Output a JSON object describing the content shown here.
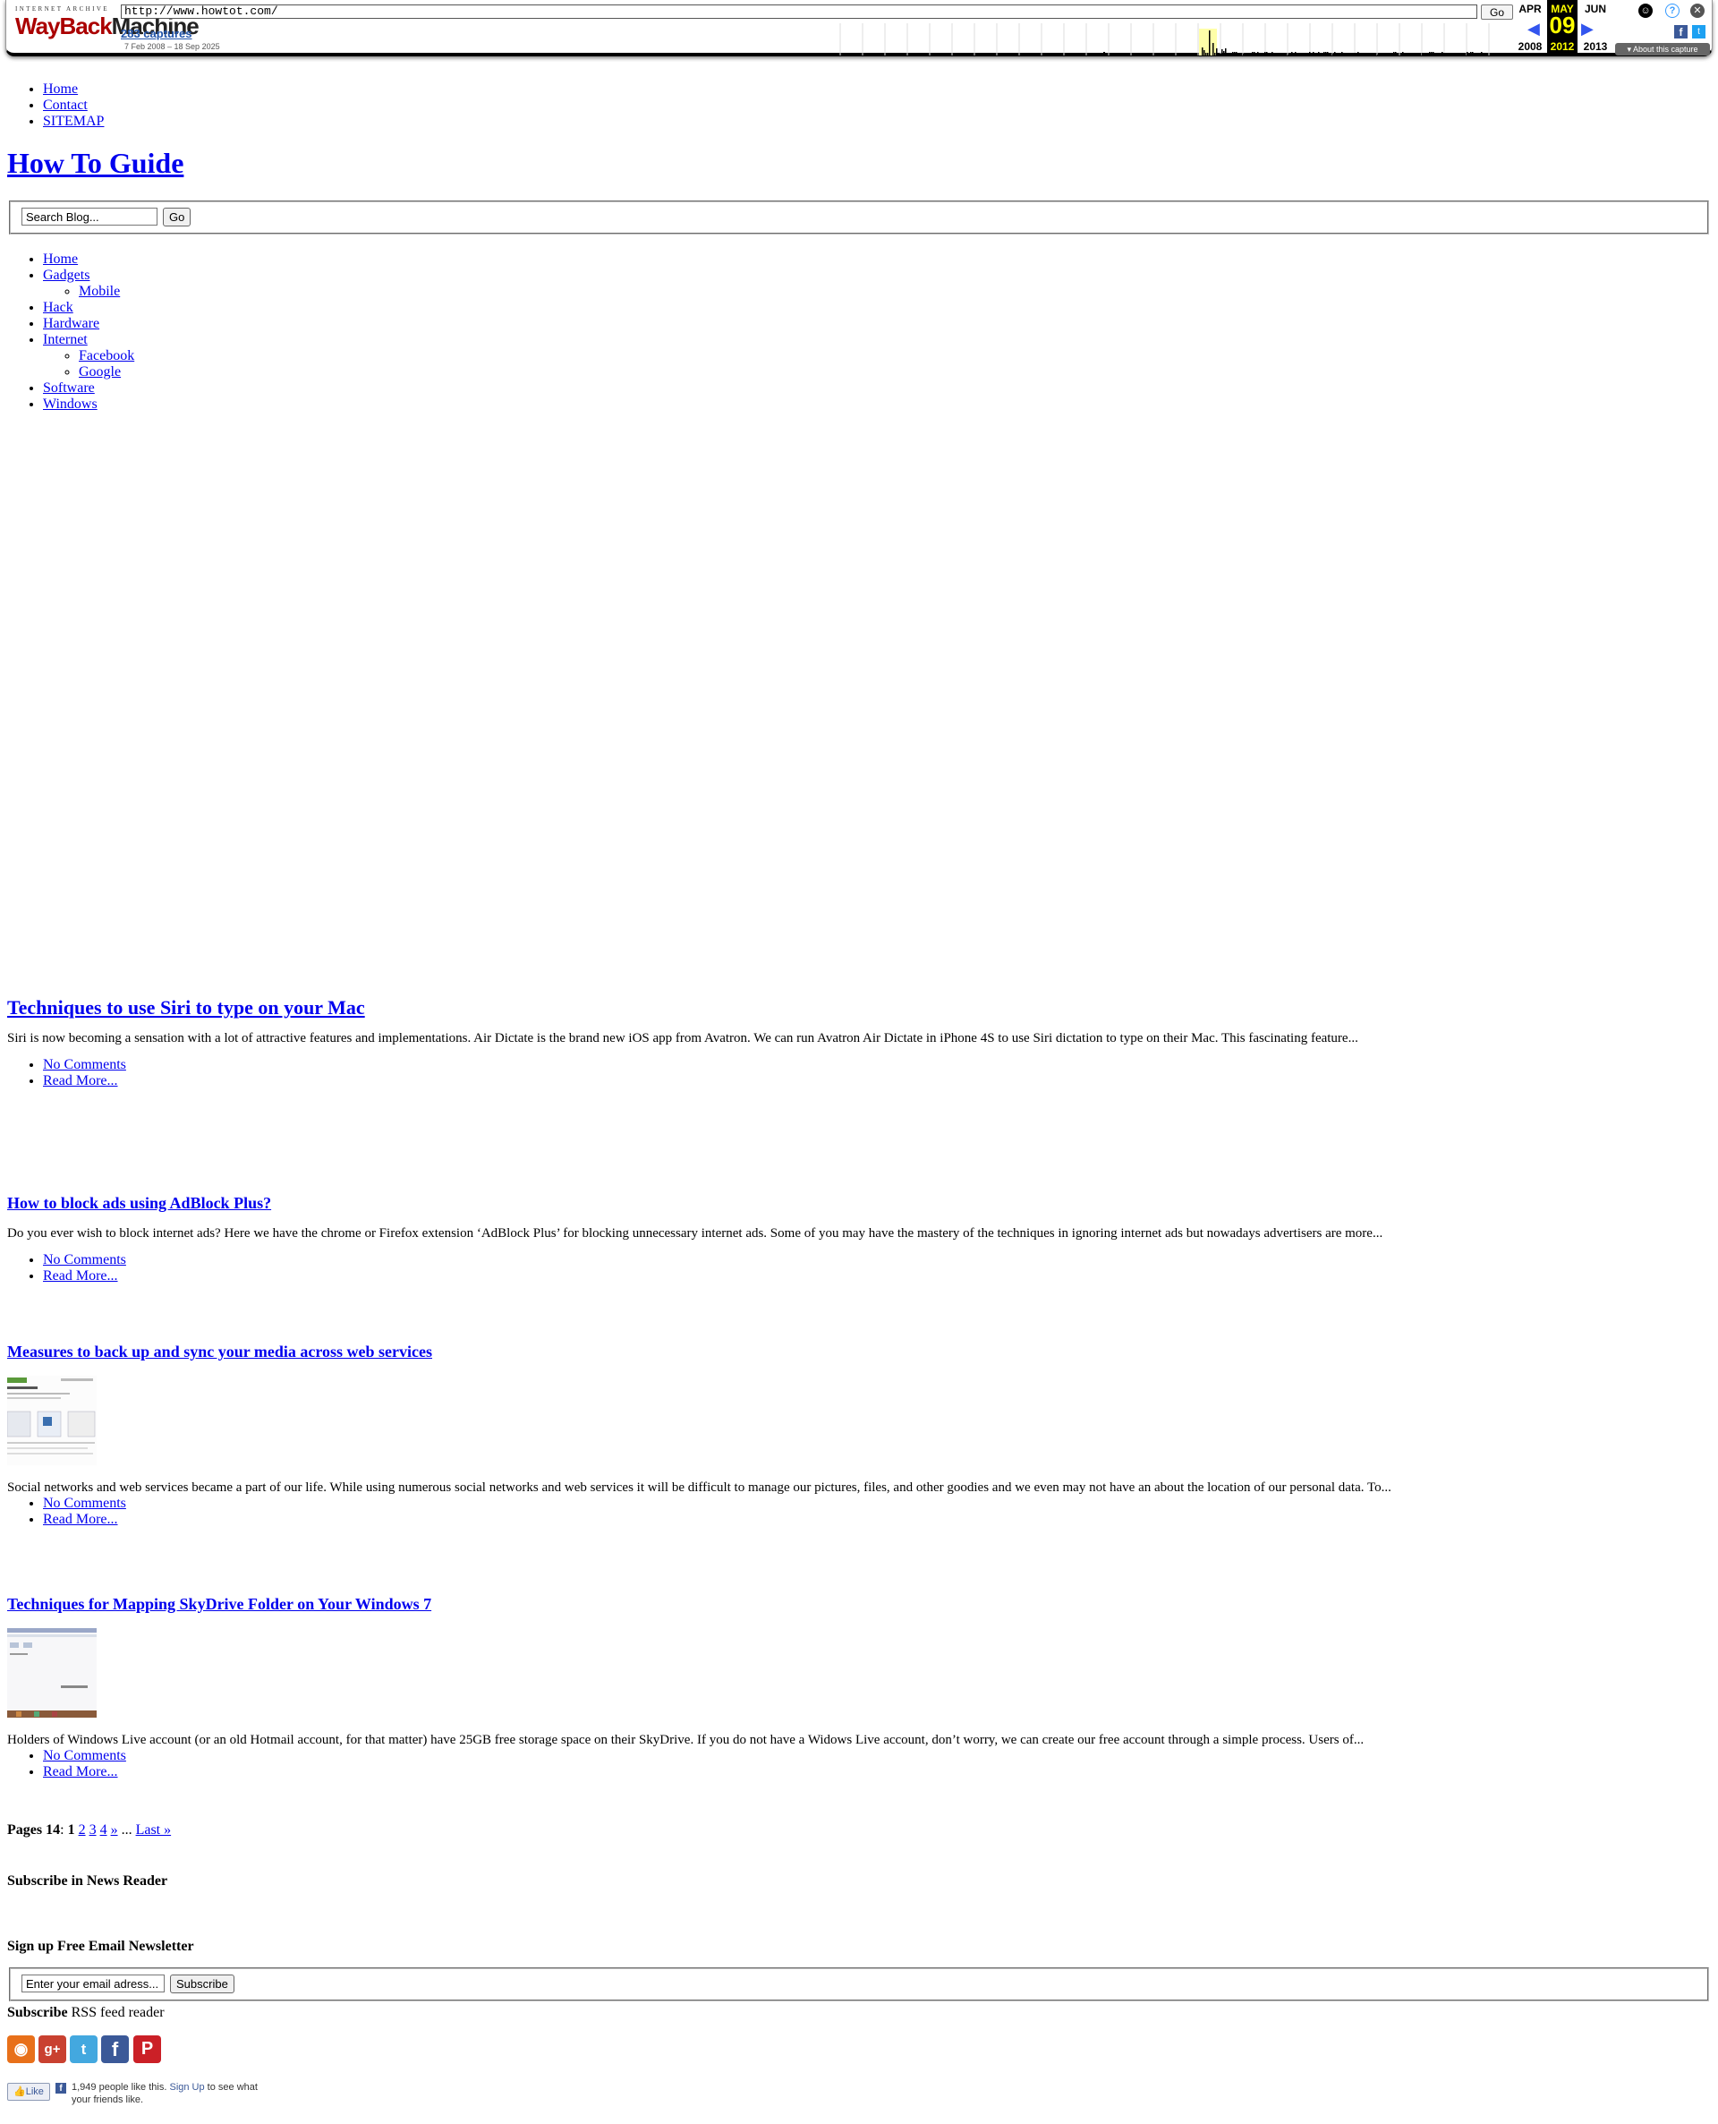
{
  "wayback": {
    "logo_top": "INTERNET ARCHIVE",
    "logo_main_red": "WayBack",
    "logo_main_dark": "Machine",
    "url": "http://www.howtot.com/",
    "go_label": "Go",
    "captures": "283 captures",
    "date_range": "7 Feb 2008 – 18 Sep 2025",
    "prev_month": "APR",
    "cur_month": "MAY",
    "next_month": "JUN",
    "cur_day": "09",
    "prev_year": "2008",
    "cur_year": "2012",
    "next_year": "2013",
    "about": "▾ About this capture"
  },
  "topnav": [
    "Home",
    "Contact",
    "SITEMAP"
  ],
  "site_title": "How To Guide",
  "search": {
    "value": "Search Blog...",
    "go": "Go"
  },
  "mainnav": {
    "home": "Home",
    "gadgets": "Gadgets",
    "mobile": "Mobile",
    "hack": "Hack",
    "hardware": "Hardware",
    "internet": "Internet",
    "facebook": "Facebook",
    "google": "Google",
    "software": "Software",
    "windows": "Windows"
  },
  "posts": [
    {
      "title": "Techniques to use Siri to type on your Mac",
      "excerpt": "Siri is now becoming a sensation with a lot of attractive features and implementations. Air Dictate is the brand new iOS app from Avatron. We can run Avatron Air Dictate in iPhone 4S to use Siri dictation to type on their Mac. This fascinating feature...",
      "comments": "No Comments",
      "more": "Read More..."
    },
    {
      "title": "How to block ads using AdBlock Plus?",
      "excerpt": "Do you ever wish to block internet ads? Here we have the chrome or Firefox extension ‘AdBlock Plus’ for blocking unnecessary internet ads. Some of you may have the mastery of the techniques in ignoring internet ads but nowadays advertisers are more...",
      "comments": "No Comments",
      "more": "Read More..."
    },
    {
      "title": "Measures to back up and sync your media across web services",
      "excerpt": "Social networks and web services became a part of our life. While using numerous social networks and web services it will be difficult to manage our pictures, files, and other goodies and we even may not have an about the location of our personal data. To...",
      "comments": "No Comments",
      "more": "Read More..."
    },
    {
      "title": "Techniques for Mapping SkyDrive Folder on Your Windows 7",
      "excerpt": "Holders of Windows Live account (or an old Hotmail account, for that matter) have 25GB free storage space on their SkyDrive. If you do not have a Widows Live account, don’t worry, we can create our free account through a simple process. Users of...",
      "comments": "No Comments",
      "more": "Read More..."
    }
  ],
  "pager": {
    "label": "Pages 14",
    "current": "1",
    "p2": "2",
    "p3": "3",
    "p4": "4",
    "next": "»",
    "dots": "...",
    "last": "Last »"
  },
  "sidebar": {
    "subscribe_reader": "Subscribe in News Reader",
    "signup_email": "Sign up Free Email Newsletter",
    "email_value": "Enter your email adress...",
    "subscribe_btn": "Subscribe",
    "rss_bold": "Subscribe",
    "rss_text": " RSS feed reader"
  },
  "social_icons": [
    "rss-icon",
    "google-plus-icon",
    "twitter-icon",
    "facebook-icon",
    "pinterest-icon"
  ],
  "fb_like": {
    "button": "Like",
    "count_text": "1,949 people like this.",
    "signup": "Sign Up",
    "rest": " to see what your friends like."
  }
}
